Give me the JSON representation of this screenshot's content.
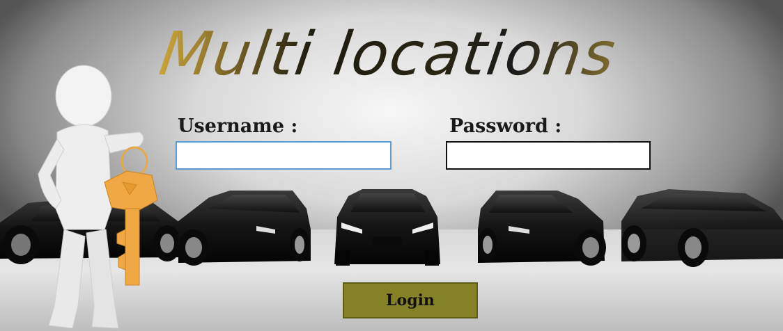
{
  "header": {
    "title": "Multi locations"
  },
  "form": {
    "username_label": "Username :",
    "username_value": "",
    "password_label": "Password :",
    "password_value": "",
    "login_label": "Login"
  },
  "illustration": {
    "figure": "person-holding-key-icon",
    "cars": "car-lineup"
  },
  "colors": {
    "button_bg": "#858225",
    "username_border": "#5b9bd5",
    "key": "#f0a844"
  }
}
